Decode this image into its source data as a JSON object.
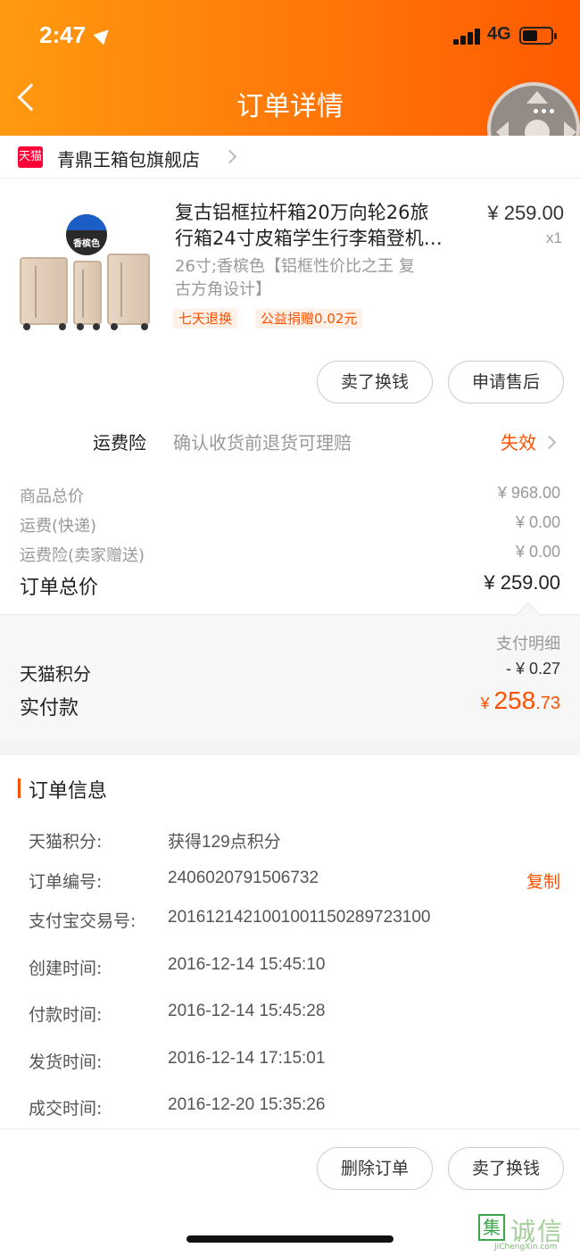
{
  "status_bar": {
    "time": "2:47",
    "network": "4G"
  },
  "header": {
    "title": "订单详情"
  },
  "store": {
    "logo_text": "天猫",
    "name": "青鼎王箱包旗舰店"
  },
  "product": {
    "title_line1": "复古铝框拉杆箱20万向轮26旅",
    "title_line2": "行箱24寸皮箱学生行李箱登机…",
    "price": "¥ 259.00",
    "quantity": "x1",
    "sku_line1": "26寸;香槟色【铝框性价比之王 复",
    "sku_line2": "古方角设计】",
    "badge": "香槟色",
    "tags": [
      "七天退换",
      "公益捐赠0.02元"
    ],
    "buttons": {
      "sell": "卖了换钱",
      "after_sale": "申请售后"
    }
  },
  "insurance": {
    "label": "运费险",
    "description": "确认收货前退货可理赔",
    "status": "失效"
  },
  "totals": {
    "rows": [
      {
        "label": "商品总价",
        "value": "¥ 968.00"
      },
      {
        "label": "运费(快递)",
        "value": "¥ 0.00"
      },
      {
        "label": "运费险(卖家赠送)",
        "value": "¥ 0.00"
      }
    ],
    "order_total_label": "订单总价",
    "order_total_value": "¥ 259.00"
  },
  "payment": {
    "detail_link": "支付明细",
    "points_label": "天猫积分",
    "points_value": "- ¥ 0.27",
    "paid_label": "实付款",
    "paid_currency": "¥ ",
    "paid_int": "258",
    "paid_dec": ".73"
  },
  "order_info": {
    "title": "订单信息",
    "copy_label": "复制",
    "rows": [
      {
        "label": "天猫积分:",
        "value": "获得129点积分"
      },
      {
        "label": "订单编号:",
        "value": "2406020791506732"
      },
      {
        "label": "支付宝交易号:",
        "value": "2016121421001001150289723100"
      },
      {
        "label": "创建时间:",
        "value": "2016-12-14 15:45:10"
      },
      {
        "label": "付款时间:",
        "value": "2016-12-14 15:45:28"
      },
      {
        "label": "发货时间:",
        "value": "2016-12-14 17:15:01"
      },
      {
        "label": "成交时间:",
        "value": "2016-12-20 15:35:26"
      }
    ]
  },
  "bottom_actions": {
    "delete": "删除订单",
    "sell": "卖了换钱"
  },
  "watermark": {
    "seal": "集",
    "text": "诚信",
    "url": "JiChengXin.com"
  },
  "colors": {
    "accent": "#ff5000",
    "header_start": "#ff9a10",
    "header_end": "#ff5a00",
    "tmall_red": "#ff0036"
  },
  "icons": [
    "location-arrow-icon",
    "signal-icon",
    "battery-icon",
    "back-icon",
    "chevron-right-icon",
    "assistive-touch-icon"
  ]
}
